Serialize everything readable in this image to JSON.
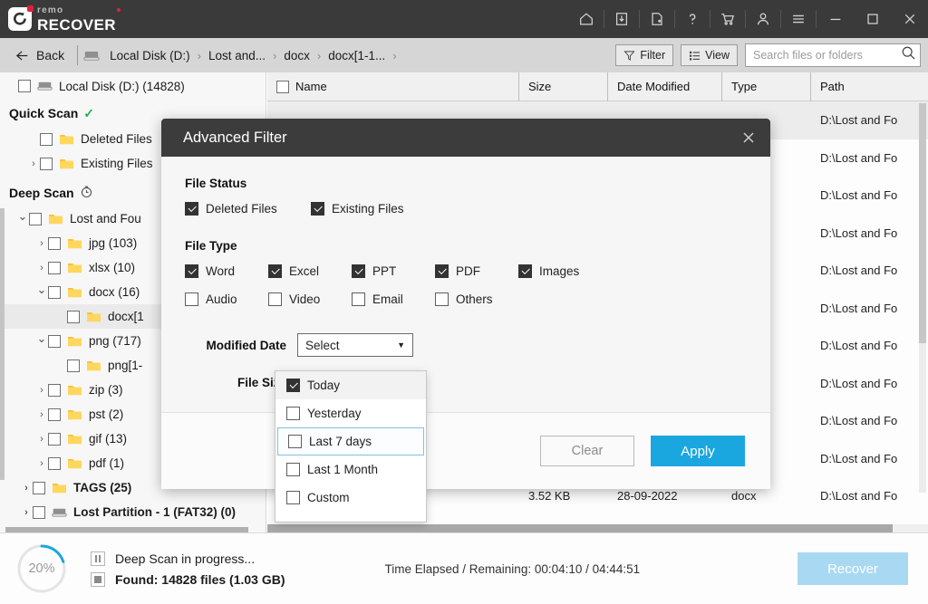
{
  "app": {
    "logo_top": "remo",
    "logo_bottom": "RECOVER"
  },
  "titlebar": {
    "icons": [
      {
        "name": "home-icon",
        "label": "Home"
      },
      {
        "name": "save-session-icon",
        "label": "Save Recovery Session"
      },
      {
        "name": "open-session-icon",
        "label": "Open Recovery Session"
      },
      {
        "name": "help-icon",
        "label": "Help"
      },
      {
        "name": "cart-icon",
        "label": "Buy Now"
      },
      {
        "name": "account-icon",
        "label": "Account"
      },
      {
        "name": "menu-icon",
        "label": "Menu"
      }
    ],
    "window_controls": [
      {
        "name": "minimize-button",
        "label": "Minimize"
      },
      {
        "name": "maximize-button",
        "label": "Maximize"
      },
      {
        "name": "close-button",
        "label": "Close"
      }
    ]
  },
  "breadcrumb": {
    "back_label": "Back",
    "items": [
      "Local Disk (D:)",
      "Lost and...",
      "docx",
      "docx[1-1...",
      ""
    ],
    "separator": "›"
  },
  "toolbar": {
    "filter_label": "Filter",
    "view_label": "View",
    "search_placeholder": "Search files or folders",
    "search_value": ""
  },
  "sidebar": {
    "root": {
      "label": "Local Disk (D:) (14828)"
    },
    "quick_scan": {
      "label": "Quick Scan",
      "status_icon": "check-icon"
    },
    "quick_items": [
      {
        "label": "Deleted Files",
        "has_chevron": false,
        "chevron": ""
      },
      {
        "label": "Existing Files",
        "has_chevron": true,
        "chevron": "›"
      }
    ],
    "deep_scan": {
      "label": "Deep Scan",
      "status_icon": "clock-icon"
    },
    "deep_items": [
      {
        "label": "Lost and Fou",
        "chevron": "⌄",
        "indent": 0,
        "expanded": true,
        "selected": false
      },
      {
        "label": "jpg (103)",
        "chevron": "›",
        "indent": 1,
        "expanded": false,
        "selected": false
      },
      {
        "label": "xlsx (10)",
        "chevron": "›",
        "indent": 1,
        "expanded": false,
        "selected": false
      },
      {
        "label": "docx (16)",
        "chevron": "⌄",
        "indent": 1,
        "expanded": true,
        "selected": false
      },
      {
        "label": "docx[1",
        "chevron": "",
        "indent": 2,
        "expanded": false,
        "selected": true
      },
      {
        "label": "png (717)",
        "chevron": "⌄",
        "indent": 1,
        "expanded": true,
        "selected": false
      },
      {
        "label": "png[1-",
        "chevron": "",
        "indent": 2,
        "expanded": false,
        "selected": false
      },
      {
        "label": "zip (3)",
        "chevron": "›",
        "indent": 1,
        "expanded": false,
        "selected": false
      },
      {
        "label": "pst (2)",
        "chevron": "›",
        "indent": 1,
        "expanded": false,
        "selected": false
      },
      {
        "label": "gif (13)",
        "chevron": "›",
        "indent": 1,
        "expanded": false,
        "selected": false
      },
      {
        "label": "pdf (1)",
        "chevron": "›",
        "indent": 1,
        "expanded": false,
        "selected": false
      }
    ],
    "tail_items": [
      {
        "label": "TAGS (25)",
        "chevron": "›",
        "icon": "folder-icon"
      },
      {
        "label": "Lost Partition - 1 (FAT32) (0)",
        "chevron": "›",
        "icon": "drive-icon"
      }
    ]
  },
  "filelist": {
    "columns": [
      "Name",
      "Size",
      "Date Modified",
      "Type",
      "Path"
    ],
    "rows": [
      {
        "name": "",
        "size": "",
        "date": "",
        "type": "",
        "path": "D:\\Lost and Fo",
        "selected": true
      },
      {
        "name": "",
        "size": "",
        "date": "",
        "type": "",
        "path": "D:\\Lost and Fo",
        "selected": false
      },
      {
        "name": "",
        "size": "",
        "date": "",
        "type": "",
        "path": "D:\\Lost and Fo",
        "selected": false
      },
      {
        "name": "",
        "size": "",
        "date": "",
        "type": "",
        "path": "D:\\Lost and Fo",
        "selected": false
      },
      {
        "name": "",
        "size": "",
        "date": "",
        "type": "",
        "path": "D:\\Lost and Fo",
        "selected": false
      },
      {
        "name": "",
        "size": "",
        "date": "",
        "type": "",
        "path": "D:\\Lost and Fo",
        "selected": false
      },
      {
        "name": "",
        "size": "",
        "date": "",
        "type": "",
        "path": "D:\\Lost and Fo",
        "selected": false
      },
      {
        "name": "",
        "size": "",
        "date": "",
        "type": "",
        "path": "D:\\Lost and Fo",
        "selected": false
      },
      {
        "name": "",
        "size": "",
        "date": "",
        "type": "",
        "path": "D:\\Lost and Fo",
        "selected": false
      },
      {
        "name": "",
        "size": "",
        "date": "",
        "type": "",
        "path": "D:\\Lost and Fo",
        "selected": false
      },
      {
        "name": "",
        "size": "3.52 KB",
        "date": "28-09-2022",
        "type": "docx",
        "path": "D:\\Lost and Fo",
        "selected": false
      }
    ]
  },
  "dialog": {
    "title": "Advanced Filter",
    "close_icon": "close-icon",
    "file_status": {
      "heading": "File Status",
      "options": [
        {
          "label": "Deleted Files",
          "checked": true
        },
        {
          "label": "Existing Files",
          "checked": true
        }
      ]
    },
    "file_type": {
      "heading": "File Type",
      "row1": [
        {
          "label": "Word",
          "checked": true
        },
        {
          "label": "Excel",
          "checked": true
        },
        {
          "label": "PPT",
          "checked": true
        },
        {
          "label": "PDF",
          "checked": true
        },
        {
          "label": "Images",
          "checked": true
        }
      ],
      "row2": [
        {
          "label": "Audio",
          "checked": false
        },
        {
          "label": "Video",
          "checked": false
        },
        {
          "label": "Email",
          "checked": false
        },
        {
          "label": "Others",
          "checked": false
        }
      ]
    },
    "modified_date": {
      "label": "Modified Date",
      "value": "Select",
      "arrow": "▼",
      "options": [
        {
          "label": "Today",
          "checked": true,
          "state": "selected"
        },
        {
          "label": "Yesterday",
          "checked": false,
          "state": ""
        },
        {
          "label": "Last 7 days",
          "checked": false,
          "state": "hover"
        },
        {
          "label": "Last 1 Month",
          "checked": false,
          "state": ""
        },
        {
          "label": "Custom",
          "checked": false,
          "state": ""
        }
      ]
    },
    "file_size": {
      "label": "File Size"
    },
    "buttons": {
      "clear_label": "Clear",
      "apply_label": "Apply"
    },
    "accent_color": "#1aa7e0"
  },
  "status": {
    "progress_percent": "20%",
    "progress_value": 20,
    "scan_text": "Deep Scan in progress...",
    "found_text": "Found: 14828 files (1.03 GB)",
    "time_text": "Time Elapsed / Remaining: 00:04:10 / 04:44:51",
    "recover_label": "Recover"
  }
}
